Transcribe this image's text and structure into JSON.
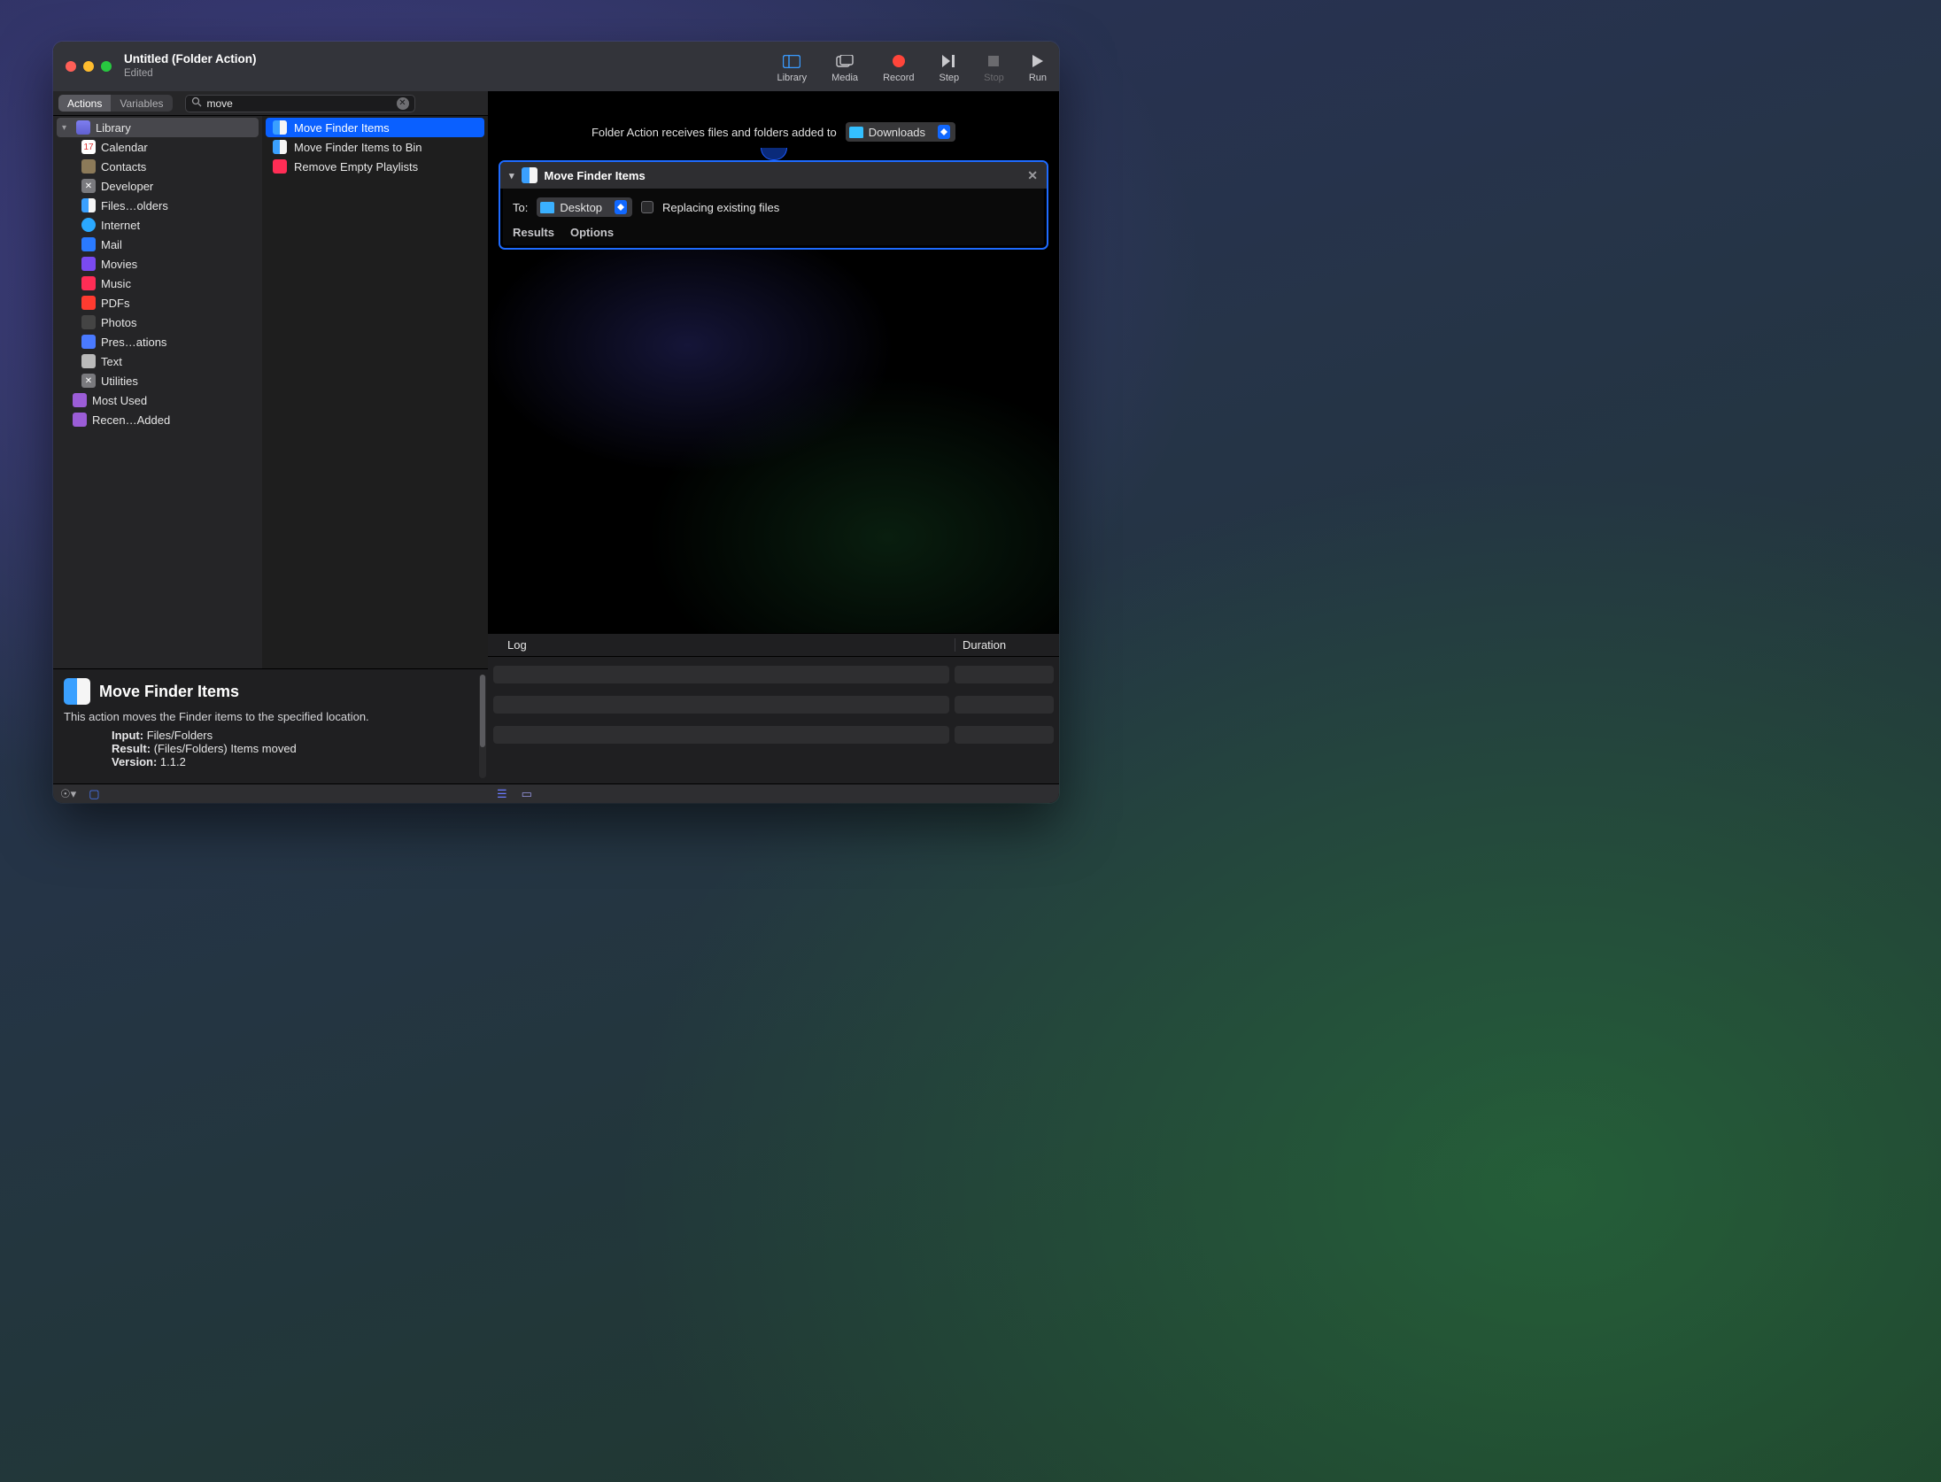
{
  "window": {
    "title": "Untitled (Folder Action)",
    "subtitle": "Edited"
  },
  "toolbar": {
    "library": "Library",
    "media": "Media",
    "record": "Record",
    "step": "Step",
    "stop": "Stop",
    "run": "Run"
  },
  "segmented": {
    "actions": "Actions",
    "variables": "Variables"
  },
  "search": {
    "value": "move"
  },
  "tree": {
    "root": "Library",
    "items": [
      "Calendar",
      "Contacts",
      "Developer",
      "Files…olders",
      "Internet",
      "Mail",
      "Movies",
      "Music",
      "PDFs",
      "Photos",
      "Pres…ations",
      "Text",
      "Utilities"
    ],
    "extra": [
      "Most Used",
      "Recen…Added"
    ]
  },
  "results": [
    "Move Finder Items",
    "Move Finder Items to Bin",
    "Remove Empty Playlists"
  ],
  "workflow_header": {
    "text": "Folder Action receives files and folders added to",
    "folder": "Downloads"
  },
  "action": {
    "title": "Move Finder Items",
    "to_label": "To:",
    "to_value": "Desktop",
    "replace": "Replacing existing files",
    "results": "Results",
    "options": "Options"
  },
  "log": {
    "col1": "Log",
    "col2": "Duration"
  },
  "info": {
    "title": "Move Finder Items",
    "desc": "This action moves the Finder items to the specified location.",
    "input_label": "Input:",
    "input_value": "Files/Folders",
    "result_label": "Result:",
    "result_value": "(Files/Folders) Items moved",
    "version_label": "Version:",
    "version_value": "1.1.2"
  }
}
